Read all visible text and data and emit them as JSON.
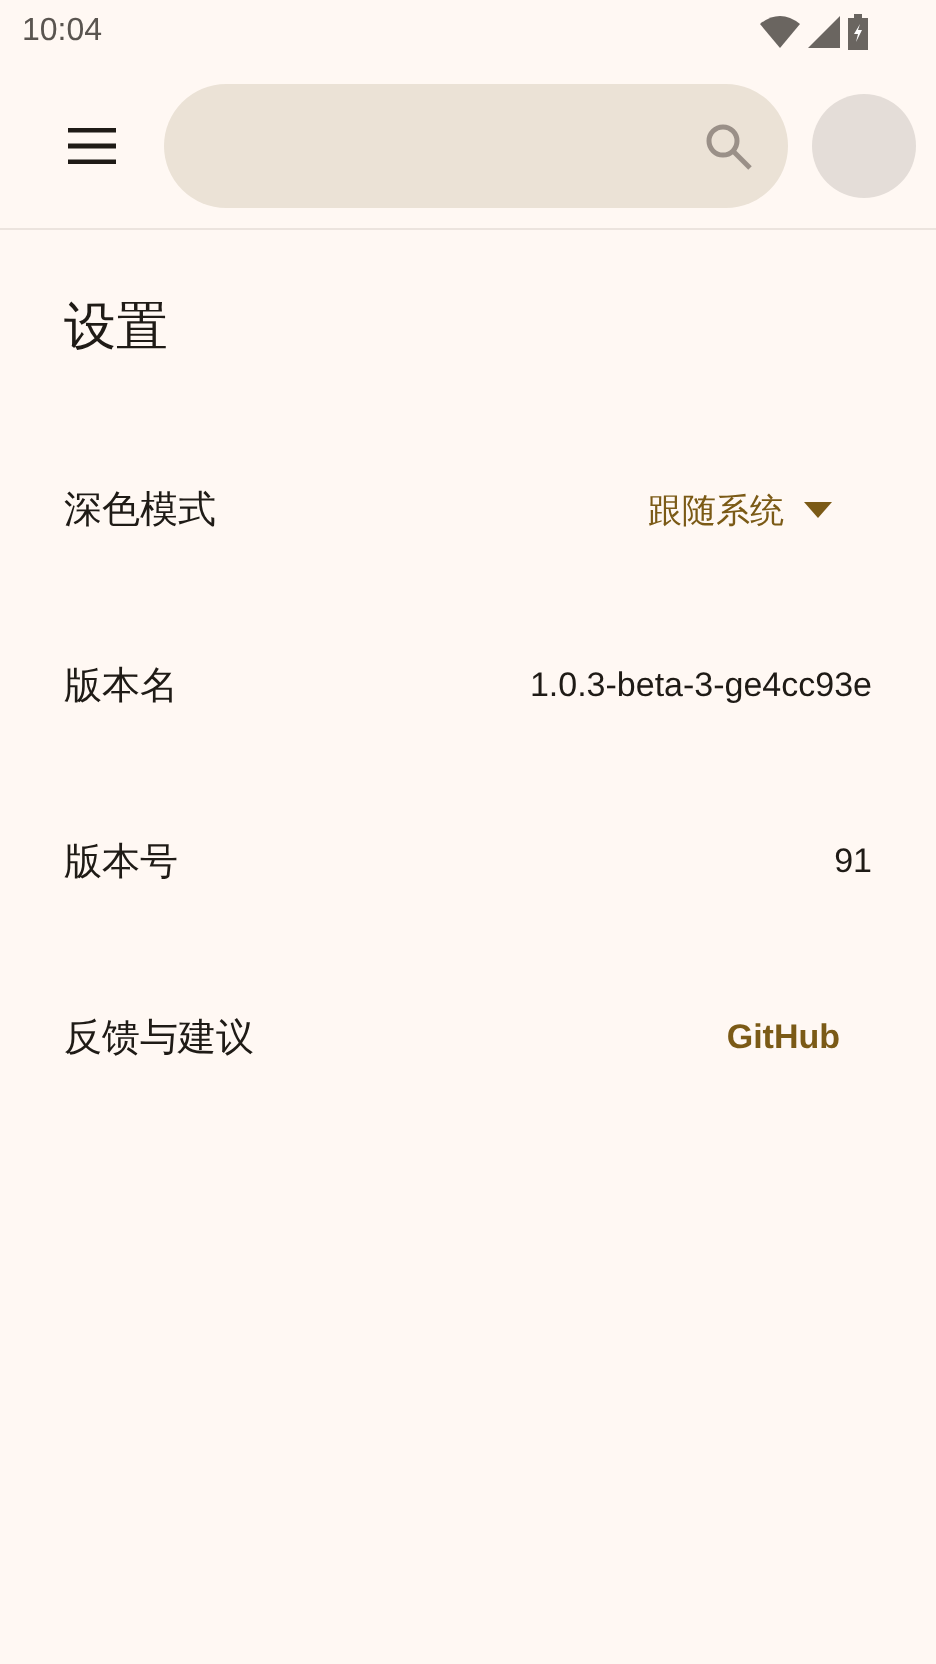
{
  "status_bar": {
    "time": "10:04"
  },
  "title": "设置",
  "settings": [
    {
      "kind": "dropdown",
      "label": "深色模式",
      "value": "跟随系统"
    },
    {
      "kind": "text",
      "label": "版本名",
      "value": "1.0.3-beta-3-ge4cc93e"
    },
    {
      "kind": "text",
      "label": "版本号",
      "value": "91"
    },
    {
      "kind": "link",
      "label": "反馈与建议",
      "value": "GitHub"
    }
  ]
}
